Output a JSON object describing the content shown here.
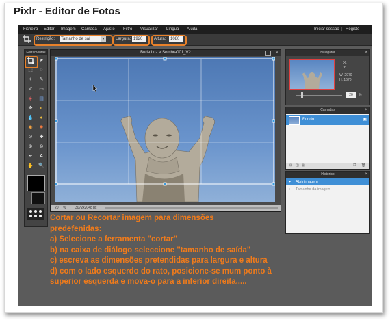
{
  "window_title": "Pixlr - Editor de Fotos",
  "menu": {
    "items": [
      "Ficheiro",
      "Editar",
      "Imagem",
      "Camada",
      "Ajuste",
      "Filtro",
      "Visualizar",
      "Língua",
      "Ajuda"
    ],
    "right": [
      "Iniciar sessão",
      "Registo"
    ]
  },
  "options": {
    "restriction_label": "Restrição:",
    "restriction_value": "Tamanho de saí",
    "width_label": "Largura:",
    "width_value": "1920",
    "height_label": "Altura:",
    "height_value": "1080"
  },
  "tools_panel": {
    "title": "Ferramentas"
  },
  "canvas": {
    "title": "Buda Luz e Sombra001_V2",
    "zoom": "20",
    "zoom_unit": "%",
    "dimensions": "3072x2048 px"
  },
  "navigator": {
    "title": "Navigator",
    "x_label": "X:",
    "y_label": "Y:",
    "w_label": "W: 2970",
    "h_label": "H: 1670",
    "zoom": "20",
    "zoom_unit": "%"
  },
  "layers": {
    "title": "Camadas",
    "items": [
      "Fundo"
    ]
  },
  "history": {
    "title": "Histórico",
    "items": [
      "Abrir imagem",
      "Tamanho da imagem"
    ]
  },
  "instructions": [
    "Cortar ou Recortar imagem para dimensões",
    "predefenidas:",
    "a) Selecione a ferramenta \"cortar\"",
    "b) na caixa de diálogo seleccione \"tamanho de saída\"",
    "c) escreva as dimensões pretendidas para largura e altura",
    "d) com o lado esquerdo do rato, posicione-se mum ponto à",
    "superior esquerda e mova-o para a inferior direita....."
  ],
  "colors": {
    "accent": "#f07b1b",
    "highlight": "#e8812a",
    "sky": "#5a86c2",
    "selection": "#3a9be0"
  }
}
